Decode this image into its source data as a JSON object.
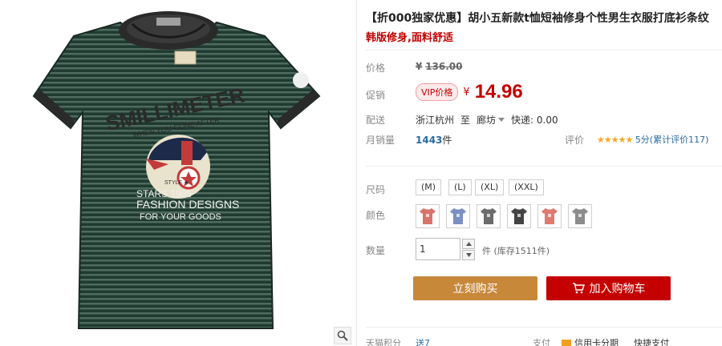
{
  "product": {
    "title": "【折000独家优惠】胡小五新款t恤短袖修身个性男生衣服打底衫条纹",
    "subtitle": "韩版修身,面料舒适",
    "image_alt": "green striped t-shirt with SMILLIMETER print"
  },
  "price_section": {
    "list_label": "价格",
    "currency": "¥",
    "original_price": "136.00",
    "promo_label": "促销",
    "vip_badge": "VIP价格",
    "current_price": "14.96"
  },
  "shipping": {
    "label": "配送",
    "from": "浙江杭州",
    "to_word": "至",
    "destination": "廊坊",
    "express": "快递: 0.00"
  },
  "sales": {
    "label": "月销量",
    "count": "1443",
    "unit": "件",
    "rating_label": "评价",
    "stars": "★★★★★",
    "score_text": "5分(累计评价117)"
  },
  "sizes": {
    "label": "尺码",
    "options": [
      "(M)",
      "(L)",
      "(XL)",
      "(XXL)"
    ]
  },
  "colors": {
    "label": "颜色",
    "swatches": [
      {
        "name": "red-shirt-swatch",
        "color": "#d9736a"
      },
      {
        "name": "blue-shirt-swatch",
        "color": "#7a8fc4"
      },
      {
        "name": "gray-dark-shirt-swatch",
        "color": "#6b6b6b"
      },
      {
        "name": "black-white-shirt-swatch",
        "color": "#444444"
      },
      {
        "name": "coral-shirt-swatch",
        "color": "#de7a70"
      },
      {
        "name": "gray-shirt-swatch",
        "color": "#8c8c8c"
      }
    ]
  },
  "quantity": {
    "label": "数量",
    "value": "1",
    "stock_text": "件 (库存1511件)"
  },
  "actions": {
    "buy_now": "立刻购买",
    "add_to_cart": "加入购物车"
  },
  "bottom": {
    "points_label": "天猫积分",
    "points_value": "送7",
    "payment_label": "支付",
    "installment": "信用卡分期",
    "express_pay": "快捷支付"
  },
  "colors_theme": {
    "accent_red": "#c40000",
    "buy_orange": "#c8883a",
    "link_blue": "#2a6aa0"
  }
}
